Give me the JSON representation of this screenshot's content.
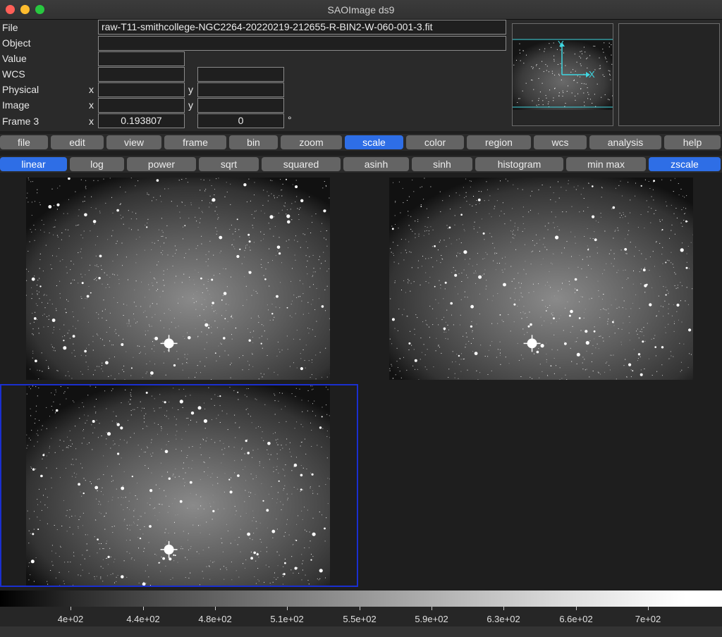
{
  "window": {
    "title": "SAOImage ds9"
  },
  "info": {
    "file_label": "File",
    "file_value": "raw-T11-smithcollege-NGC2264-20220219-212655-R-BIN2-W-060-001-3.fit",
    "object_label": "Object",
    "object_value": "",
    "value_label": "Value",
    "value_value": "",
    "wcs_label": "WCS",
    "physical_label": "Physical",
    "image_label": "Image",
    "frame_label": "Frame 3",
    "x_axis": "x",
    "y_axis": "y",
    "frame_x_value": "0.193807",
    "frame_y_value": "0",
    "degree_symbol": "°",
    "panner_x_label": "X",
    "panner_y_label": "Y"
  },
  "menu": [
    {
      "label": "file"
    },
    {
      "label": "edit"
    },
    {
      "label": "view"
    },
    {
      "label": "frame"
    },
    {
      "label": "bin"
    },
    {
      "label": "zoom"
    },
    {
      "label": "scale",
      "active": true
    },
    {
      "label": "color"
    },
    {
      "label": "region"
    },
    {
      "label": "wcs"
    },
    {
      "label": "analysis"
    },
    {
      "label": "help"
    }
  ],
  "scale_buttons": [
    {
      "label": "linear",
      "active": true
    },
    {
      "label": "log"
    },
    {
      "label": "power"
    },
    {
      "label": "sqrt"
    },
    {
      "label": "squared"
    },
    {
      "label": "asinh"
    },
    {
      "label": "sinh"
    },
    {
      "label": "histogram"
    },
    {
      "label": "min max"
    },
    {
      "label": "zscale",
      "active": true
    }
  ],
  "colorbar": {
    "tick_labels": [
      "4e+02",
      "4.4e+02",
      "4.8e+02",
      "5.1e+02",
      "5.5e+02",
      "5.9e+02",
      "6.3e+02",
      "6.6e+02",
      "7e+02"
    ]
  },
  "colors": {
    "accent": "#2e6ee6",
    "current_frame_border": "#1a2fd0",
    "panner_cyan": "#3fd6e0"
  }
}
